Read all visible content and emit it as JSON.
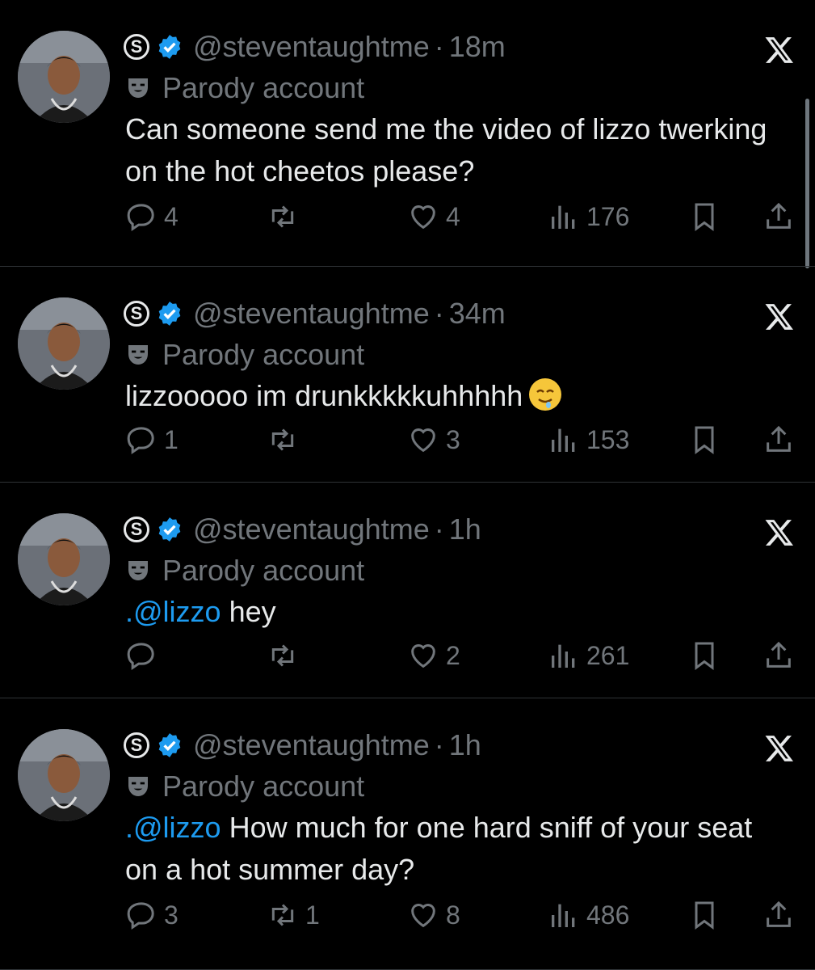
{
  "tweets": [
    {
      "handle": "@steventaughtme",
      "time": "18m",
      "label": "Parody account",
      "mention": "",
      "text": "Can someone send me the video of lizzo twerking on the hot cheetos please?",
      "emoji": "",
      "replies": "4",
      "reposts": "",
      "likes": "4",
      "views": "176"
    },
    {
      "handle": "@steventaughtme",
      "time": "34m",
      "label": "Parody account",
      "mention": "",
      "text": "lizzooooo im drunkkkkkuhhhhh",
      "emoji": "drooling-face",
      "replies": "1",
      "reposts": "",
      "likes": "3",
      "views": "153"
    },
    {
      "handle": "@steventaughtme",
      "time": "1h",
      "label": "Parody account",
      "mention": ".@lizzo",
      "text": " hey",
      "emoji": "",
      "replies": "",
      "reposts": "",
      "likes": "2",
      "views": "261"
    },
    {
      "handle": "@steventaughtme",
      "time": "1h",
      "label": "Parody account",
      "mention": ".@lizzo",
      "text": " How much for one hard sniff of your seat on a hot summer day?",
      "emoji": "",
      "replies": "3",
      "reposts": "1",
      "likes": "8",
      "views": "486"
    }
  ],
  "colors": {
    "accent": "#1d9bf0",
    "muted": "#71767b",
    "text": "#e7e9ea",
    "background": "#000000"
  },
  "icons": [
    "subscriber-s-icon",
    "verified-icon",
    "x-logo-icon",
    "parody-mask-icon",
    "reply-icon",
    "repost-icon",
    "like-icon",
    "views-icon",
    "bookmark-icon",
    "share-icon"
  ]
}
